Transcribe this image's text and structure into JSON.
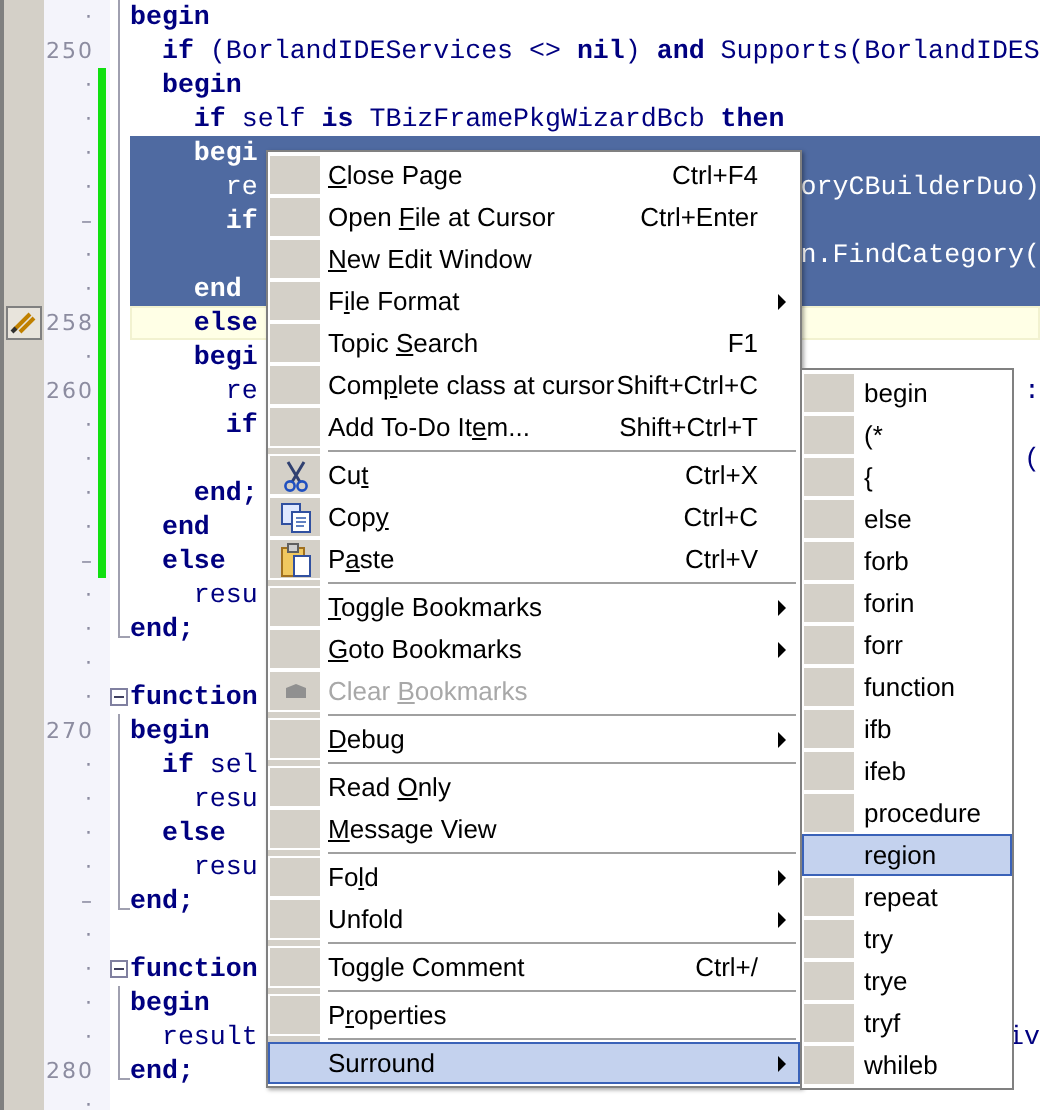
{
  "editor": {
    "lines": [
      {
        "gutter": "·",
        "kind": "body",
        "modified": false,
        "selected": false,
        "current": false,
        "bookmark": false,
        "code": "**begin**"
      },
      {
        "gutter": "250",
        "kind": "body",
        "modified": false,
        "selected": false,
        "current": false,
        "bookmark": false,
        "code": "  **if** (BorlandIDEServices <> **nil**) **and** Supports(BorlandIDES"
      },
      {
        "gutter": "·",
        "kind": "body",
        "modified": true,
        "selected": false,
        "current": false,
        "bookmark": false,
        "code": "  **begin**"
      },
      {
        "gutter": "·",
        "kind": "body",
        "modified": true,
        "selected": false,
        "current": false,
        "bookmark": false,
        "code": "    **if** self **is** TBizFramePkgWizardBcb **then**"
      },
      {
        "gutter": "·",
        "kind": "body",
        "modified": true,
        "selected": true,
        "current": false,
        "bookmark": false,
        "code": "    **begi**"
      },
      {
        "gutter": "·",
        "kind": "body",
        "modified": true,
        "selected": true,
        "current": false,
        "bookmark": false,
        "code": "      re",
        "tail": "oryCBuilderDuo)"
      },
      {
        "gutter": "–",
        "kind": "body",
        "modified": true,
        "selected": true,
        "current": false,
        "bookmark": false,
        "code": "      **if**"
      },
      {
        "gutter": "·",
        "kind": "body",
        "modified": true,
        "selected": true,
        "current": false,
        "bookmark": false,
        "tail": "n.FindCategory("
      },
      {
        "gutter": "·",
        "kind": "body",
        "modified": true,
        "selected": true,
        "current": false,
        "bookmark": false,
        "code": "    **end**"
      },
      {
        "gutter": "258",
        "kind": "body",
        "modified": true,
        "selected": false,
        "current": true,
        "bookmark": true,
        "code": "    **else**"
      },
      {
        "gutter": "·",
        "kind": "body",
        "modified": true,
        "selected": false,
        "current": false,
        "bookmark": false,
        "code": "    **begi**"
      },
      {
        "gutter": "260",
        "kind": "body",
        "modified": true,
        "selected": false,
        "current": false,
        "bookmark": false,
        "code": "      re",
        "tail": ":"
      },
      {
        "gutter": "·",
        "kind": "body",
        "modified": true,
        "selected": false,
        "current": false,
        "bookmark": false,
        "code": "      **if**"
      },
      {
        "gutter": "·",
        "kind": "body",
        "modified": true,
        "selected": false,
        "current": false,
        "bookmark": false,
        "tail": "("
      },
      {
        "gutter": "·",
        "kind": "body",
        "modified": true,
        "selected": false,
        "current": false,
        "bookmark": false,
        "code": "    **end;**"
      },
      {
        "gutter": "·",
        "kind": "body",
        "modified": true,
        "selected": false,
        "current": false,
        "bookmark": false,
        "code": "  **end**"
      },
      {
        "gutter": "–",
        "kind": "body",
        "modified": true,
        "selected": false,
        "current": false,
        "bookmark": false,
        "code": "  **else**"
      },
      {
        "gutter": "·",
        "kind": "body",
        "modified": false,
        "selected": false,
        "current": false,
        "bookmark": false,
        "code": "    resu"
      },
      {
        "gutter": "·",
        "kind": "end",
        "modified": false,
        "selected": false,
        "current": false,
        "bookmark": false,
        "code": "**end;**"
      },
      {
        "gutter": "·",
        "kind": "plain",
        "modified": false,
        "selected": false,
        "current": false,
        "bookmark": false
      },
      {
        "gutter": "·",
        "kind": "start",
        "modified": false,
        "selected": false,
        "current": false,
        "bookmark": false,
        "code": "**function**"
      },
      {
        "gutter": "270",
        "kind": "body",
        "modified": false,
        "selected": false,
        "current": false,
        "bookmark": false,
        "code": "**begin**"
      },
      {
        "gutter": "·",
        "kind": "body",
        "modified": false,
        "selected": false,
        "current": false,
        "bookmark": false,
        "code": "  **if** sel"
      },
      {
        "gutter": "·",
        "kind": "body",
        "modified": false,
        "selected": false,
        "current": false,
        "bookmark": false,
        "code": "    resu"
      },
      {
        "gutter": "·",
        "kind": "body",
        "modified": false,
        "selected": false,
        "current": false,
        "bookmark": false,
        "code": "  **else**"
      },
      {
        "gutter": "·",
        "kind": "body",
        "modified": false,
        "selected": false,
        "current": false,
        "bookmark": false,
        "code": "    resu"
      },
      {
        "gutter": "–",
        "kind": "end",
        "modified": false,
        "selected": false,
        "current": false,
        "bookmark": false,
        "code": "**end;**"
      },
      {
        "gutter": "·",
        "kind": "plain",
        "modified": false,
        "selected": false,
        "current": false,
        "bookmark": false
      },
      {
        "gutter": "·",
        "kind": "start",
        "modified": false,
        "selected": false,
        "current": false,
        "bookmark": false,
        "code": "**function**"
      },
      {
        "gutter": "·",
        "kind": "body",
        "modified": false,
        "selected": false,
        "current": false,
        "bookmark": false,
        "code": "**begin**"
      },
      {
        "gutter": "·",
        "kind": "body",
        "modified": false,
        "selected": false,
        "current": false,
        "bookmark": false,
        "code": "  result",
        "tail": "iv"
      },
      {
        "gutter": "280",
        "kind": "end",
        "modified": false,
        "selected": false,
        "current": false,
        "bookmark": false,
        "code": "**end;**"
      },
      {
        "gutter": "·",
        "kind": "plain",
        "modified": false,
        "selected": false,
        "current": false,
        "bookmark": false
      }
    ]
  },
  "context_menu": {
    "items": [
      {
        "kind": "item",
        "key": "C",
        "post": "lose Page",
        "shortcut": "Ctrl+F4",
        "submenu": false,
        "disabled": false,
        "selected": false
      },
      {
        "kind": "item",
        "pre": "Open ",
        "key": "F",
        "post": "ile at Cursor",
        "shortcut": "Ctrl+Enter",
        "submenu": false,
        "disabled": false,
        "selected": false
      },
      {
        "kind": "item",
        "key": "N",
        "post": "ew Edit Window",
        "submenu": false,
        "disabled": false,
        "selected": false
      },
      {
        "kind": "item",
        "pre": "F",
        "key": "i",
        "post": "le Format",
        "submenu": true,
        "disabled": false,
        "selected": false
      },
      {
        "kind": "item",
        "pre": "Topic ",
        "key": "S",
        "post": "earch",
        "shortcut": "F1",
        "submenu": false,
        "disabled": false,
        "selected": false
      },
      {
        "kind": "item",
        "pre": "Com",
        "key": "p",
        "post": "lete class at cursor",
        "shortcut": "Shift+Ctrl+C",
        "submenu": false,
        "disabled": false,
        "selected": false
      },
      {
        "kind": "item",
        "pre": "Add To-Do It",
        "key": "e",
        "post": "m...",
        "shortcut": "Shift+Ctrl+T",
        "submenu": false,
        "disabled": false,
        "selected": false
      },
      {
        "kind": "separator"
      },
      {
        "kind": "cut",
        "pre": "Cu",
        "key": "t",
        "shortcut": "Ctrl+X",
        "submenu": false,
        "disabled": false,
        "selected": false
      },
      {
        "kind": "copy",
        "pre": "Cop",
        "key": "y",
        "shortcut": "Ctrl+C",
        "submenu": false,
        "disabled": false,
        "selected": false
      },
      {
        "kind": "paste",
        "pre": "P",
        "key": "a",
        "post": "ste",
        "shortcut": "Ctrl+V",
        "submenu": false,
        "disabled": false,
        "selected": false
      },
      {
        "kind": "separator"
      },
      {
        "kind": "item",
        "key": "T",
        "post": "oggle Bookmarks",
        "submenu": true,
        "disabled": false,
        "selected": false
      },
      {
        "kind": "item",
        "key": "G",
        "post": "oto Bookmarks",
        "submenu": true,
        "disabled": false,
        "selected": false
      },
      {
        "kind": "clear",
        "pre": "Clear ",
        "key": "B",
        "post": "ookmarks",
        "submenu": false,
        "disabled": true,
        "selected": false
      },
      {
        "kind": "separator"
      },
      {
        "kind": "item",
        "key": "D",
        "post": "ebug",
        "submenu": true,
        "disabled": false,
        "selected": false
      },
      {
        "kind": "separator"
      },
      {
        "kind": "item",
        "pre": "Read ",
        "key": "O",
        "post": "nly",
        "submenu": false,
        "disabled": false,
        "selected": false
      },
      {
        "kind": "item",
        "key": "M",
        "post": "essage View",
        "submenu": false,
        "disabled": false,
        "selected": false
      },
      {
        "kind": "separator"
      },
      {
        "kind": "item",
        "pre": "Fo",
        "key": "l",
        "post": "d",
        "submenu": true,
        "disabled": false,
        "selected": false
      },
      {
        "kind": "item",
        "pre": "Unfold",
        "submenu": true,
        "disabled": false,
        "selected": false
      },
      {
        "kind": "separator"
      },
      {
        "kind": "item",
        "pre": "Toggle Comment",
        "shortcut": "Ctrl+/",
        "submenu": false,
        "disabled": false,
        "selected": false
      },
      {
        "kind": "separator"
      },
      {
        "kind": "item",
        "pre": "P",
        "key": "r",
        "post": "operties",
        "submenu": false,
        "disabled": false,
        "selected": false
      },
      {
        "kind": "separator"
      },
      {
        "kind": "item",
        "pre": "Surround",
        "submenu": true,
        "disabled": false,
        "selected": true
      }
    ]
  },
  "submenu": {
    "items": [
      {
        "label": "begin",
        "selected": false
      },
      {
        "label": "(*",
        "selected": false
      },
      {
        "label": "{",
        "selected": false
      },
      {
        "label": "else",
        "selected": false
      },
      {
        "label": "forb",
        "selected": false
      },
      {
        "label": "forin",
        "selected": false
      },
      {
        "label": "forr",
        "selected": false
      },
      {
        "label": "function",
        "selected": false
      },
      {
        "label": "ifb",
        "selected": false
      },
      {
        "label": "ifeb",
        "selected": false
      },
      {
        "label": "procedure",
        "selected": false
      },
      {
        "label": "region",
        "selected": true
      },
      {
        "label": "repeat",
        "selected": false
      },
      {
        "label": "try",
        "selected": false
      },
      {
        "label": "trye",
        "selected": false
      },
      {
        "label": "tryf",
        "selected": false
      },
      {
        "label": "whileb",
        "selected": false
      }
    ]
  }
}
